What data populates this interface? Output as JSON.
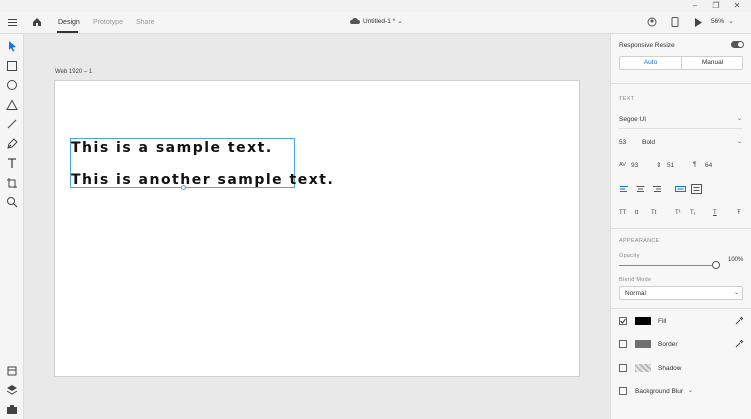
{
  "window": {
    "minimize": "–",
    "maximize": "❐",
    "close": "✕"
  },
  "topbar": {
    "tabs": [
      {
        "label": "Design",
        "active": true
      },
      {
        "label": "Prototype",
        "active": false
      },
      {
        "label": "Share",
        "active": false
      }
    ],
    "doc_title": "Untitled-1 *",
    "zoom": "56%"
  },
  "toolbar": {
    "tools": [
      "select-tool",
      "rectangle-tool",
      "ellipse-tool",
      "polygon-tool",
      "line-tool",
      "pen-tool",
      "text-tool",
      "artboard-tool",
      "zoom-tool"
    ],
    "bottom": [
      "assets-icon",
      "layers-icon",
      "plugins-icon"
    ]
  },
  "canvas": {
    "artboard_label": "Web 1920 – 1",
    "text_lines": [
      "This is a sample text.",
      "This is another sample text."
    ]
  },
  "panel": {
    "responsive_resize": "Responsive Resize",
    "auto": "Auto",
    "manual": "Manual",
    "text_section": "TEXT",
    "font_family": "Segoe UI",
    "font_size": "53",
    "font_weight": "Bold",
    "char_spacing": "93",
    "line_spacing": "51",
    "para_spacing": "64",
    "transforms": [
      "TT",
      "tt",
      "Tt",
      "T¹",
      "T₁",
      "T",
      "Ŧ"
    ],
    "appearance_section": "APPEARANCE",
    "opacity_label": "Opacity",
    "opacity_value": "100%",
    "blend_label": "Blend Mode",
    "blend_value": "Normal",
    "fill_label": "Fill",
    "border_label": "Border",
    "shadow_label": "Shadow",
    "blur_label": "Background Blur",
    "colors": {
      "fill": "#000000",
      "border": "#707070",
      "accent": "#1473e6",
      "selection": "#4ea5e6"
    }
  }
}
